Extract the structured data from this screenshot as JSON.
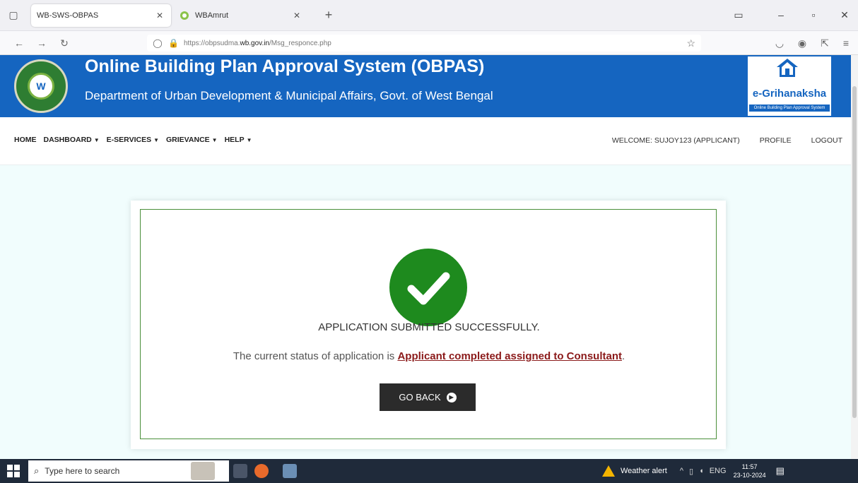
{
  "browser": {
    "tabs": [
      {
        "title": "WB-SWS-OBPAS",
        "active": true
      },
      {
        "title": "WBAmrut",
        "active": false
      }
    ],
    "url_prefix": "https://obpsudma.",
    "url_domain": "wb.gov.in",
    "url_path": "/Msg_responce.php"
  },
  "header": {
    "title": "Online Building Plan Approval System (OBPAS)",
    "subtitle": "Department of Urban Development & Municipal Affairs, Govt. of West Bengal",
    "logo_text": "e-Grihanaksha",
    "logo_tagline": "Online Building Plan Approval System"
  },
  "menu": {
    "left": [
      {
        "label": "HOME",
        "dropdown": false
      },
      {
        "label": "DASHBOARD",
        "dropdown": true
      },
      {
        "label": "E-SERVICES",
        "dropdown": true
      },
      {
        "label": "GRIEVANCE",
        "dropdown": true
      },
      {
        "label": "HELP",
        "dropdown": true
      }
    ],
    "welcome": "WELCOME: SUJOY123 (APPLICANT)",
    "profile": "PROFILE",
    "logout": "LOGOUT"
  },
  "message": {
    "success": "APPLICATION SUBMITTED SUCCESSFULLY.",
    "status_prefix": "The current status of application is ",
    "status_value": "Applicant completed assigned to Consultant",
    "status_suffix": ".",
    "button": "GO BACK"
  },
  "taskbar": {
    "search_placeholder": "Type here to search",
    "weather": "Weather alert",
    "lang": "ENG",
    "time": "11:57",
    "date": "23-10-2024"
  },
  "colors": {
    "header_bg": "#1565c0",
    "success_green": "#1e8a1e",
    "status_red": "#8b1a1a",
    "button_bg": "#2b2b2b",
    "content_bg": "#f1fdfd"
  }
}
